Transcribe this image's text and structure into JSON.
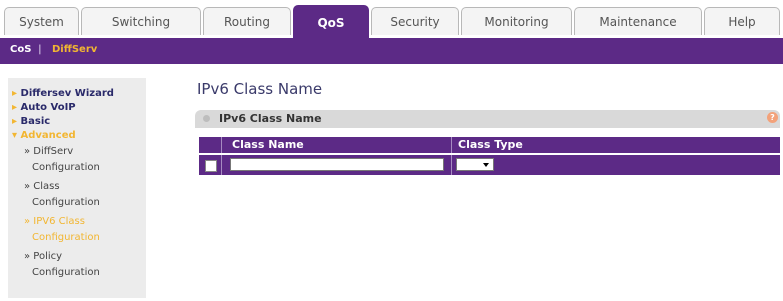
{
  "tabs": [
    {
      "label": "System"
    },
    {
      "label": "Switching"
    },
    {
      "label": "Routing"
    },
    {
      "label": "QoS",
      "active": true
    },
    {
      "label": "Security"
    },
    {
      "label": "Monitoring"
    },
    {
      "label": "Maintenance"
    },
    {
      "label": "Help"
    }
  ],
  "subnav": {
    "cos": "CoS",
    "separator": "|",
    "diffserv": "DiffServ"
  },
  "sidebar": {
    "items": [
      {
        "label": "Differsev Wizard"
      },
      {
        "label": "Auto VoIP"
      },
      {
        "label": "Basic"
      },
      {
        "label": "Advanced"
      },
      {
        "label": "» DiffServ"
      },
      {
        "label": "Configuration"
      },
      {
        "label": "» Class"
      },
      {
        "label": "Configuration"
      },
      {
        "label": "» IPV6 Class"
      },
      {
        "label": "Configuration"
      },
      {
        "label": "» Policy"
      },
      {
        "label": "Configuration"
      }
    ]
  },
  "main": {
    "title": "IPv6 Class Name",
    "panel_title": "IPv6 Class Name",
    "columns": {
      "class_name": "Class Name",
      "class_type": "Class Type"
    },
    "row": {
      "class_name_value": "",
      "class_type_value": ""
    }
  },
  "colors": {
    "accent": "#5c2a86",
    "selected": "#f2b632",
    "sidebar_bg": "#ececec"
  }
}
